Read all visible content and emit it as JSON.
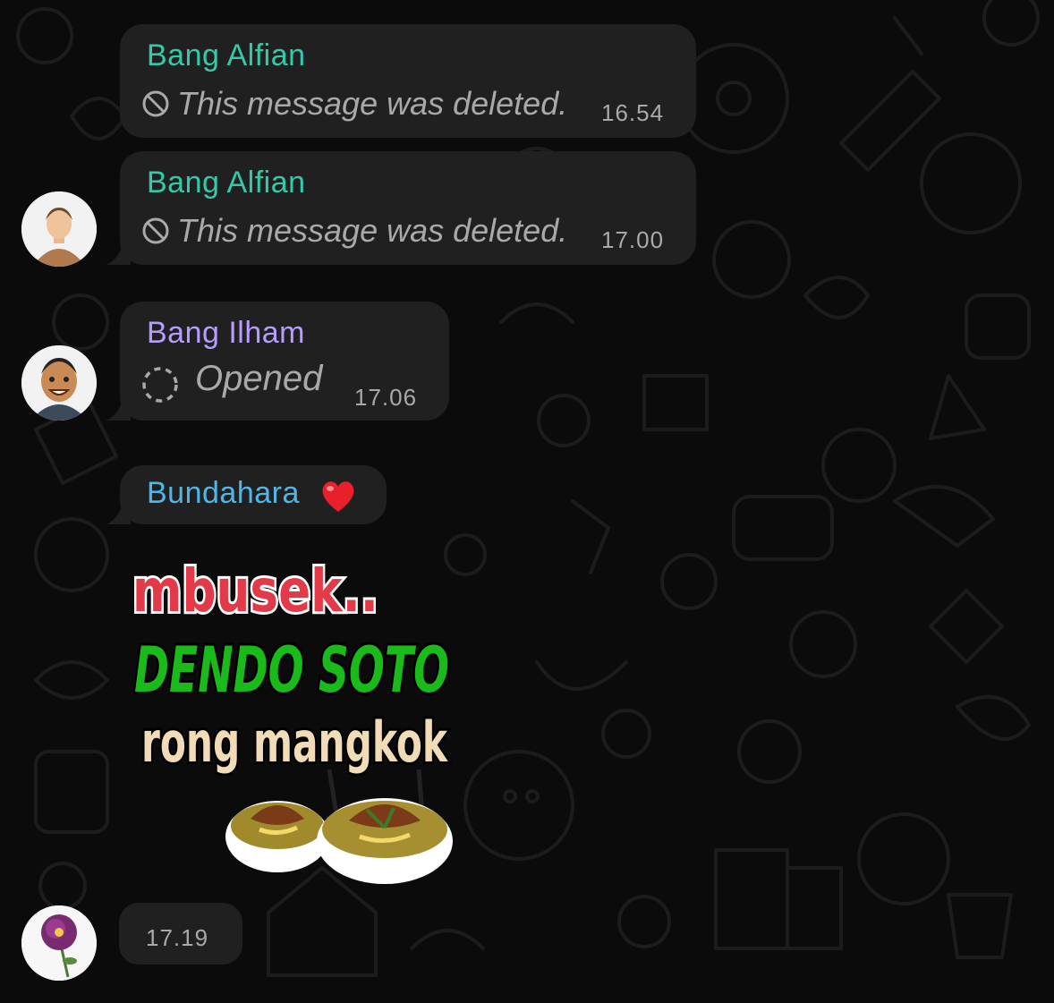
{
  "colors": {
    "background": "#0b0b0b",
    "bubble": "#202020",
    "meta_text": "#a9a9a9",
    "sender_alfian": "#35c9a9",
    "sender_ilham": "#b79cff",
    "sender_bundahara": "#4fb6e8"
  },
  "messages": [
    {
      "sender": "Bang Alfian",
      "text": "This message was deleted.",
      "time": "16.54",
      "icon": "deleted-icon"
    },
    {
      "sender": "Bang Alfian",
      "text": "This message was deleted.",
      "time": "17.00",
      "icon": "deleted-icon"
    },
    {
      "sender": "Bang Ilham",
      "text": "Opened",
      "time": "17.06",
      "icon": "view-once-opened-icon"
    },
    {
      "sender": "Bundahara",
      "sender_emoji": "❤️"
    },
    {
      "sticker": {
        "line1": "mbusek..",
        "line2": "DENDO SOTO",
        "line3": "rong mangkok"
      },
      "time": "17.19"
    }
  ]
}
